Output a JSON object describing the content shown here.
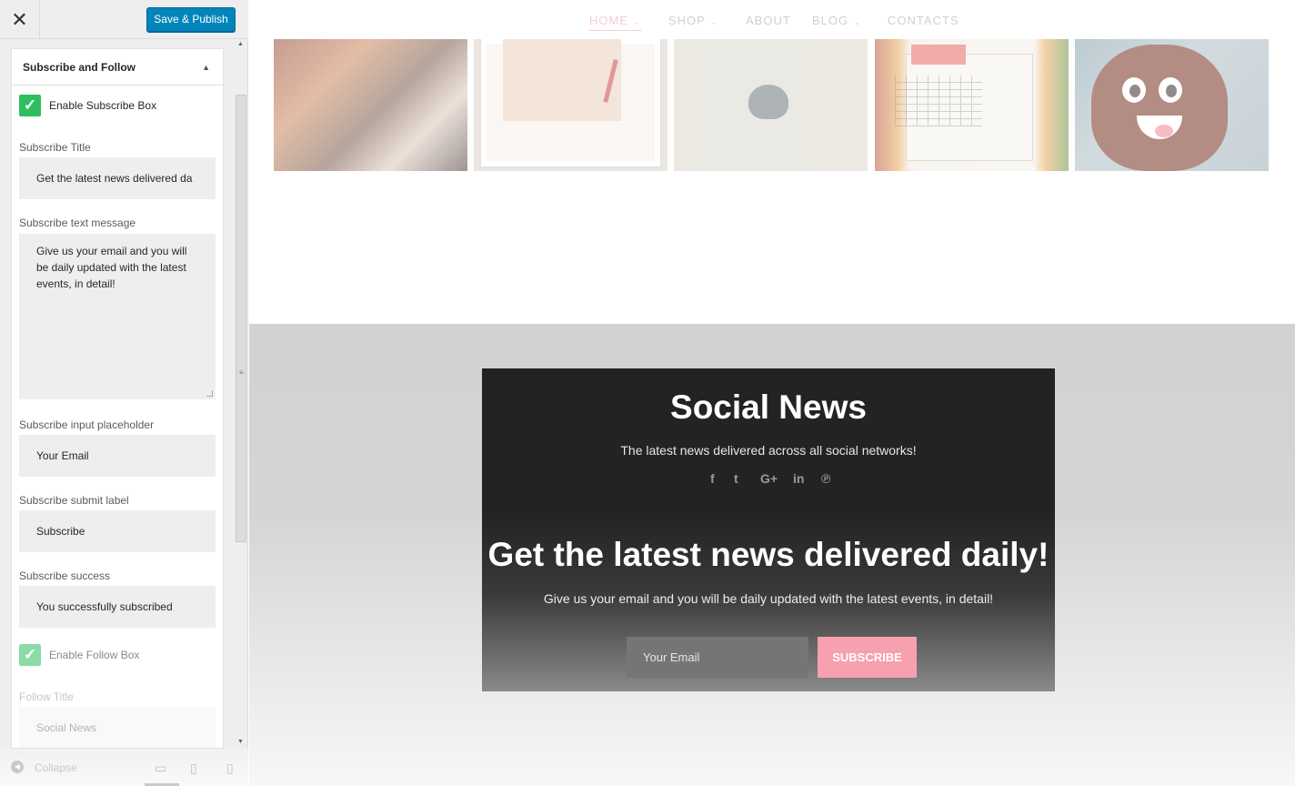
{
  "customizer": {
    "close_glyph": "✕",
    "publish_label": "Save & Publish",
    "section_title": "Subscribe and Follow",
    "enable_subscribe_label": "Enable Subscribe Box",
    "fields": {
      "subscribe_title_label": "Subscribe Title",
      "subscribe_title_value": "Get the latest news delivered da",
      "subscribe_text_label": "Subscribe text message",
      "subscribe_text_value": "Give us your email and you will be daily updated with the latest events, in detail!",
      "input_placeholder_label": "Subscribe input placeholder",
      "input_placeholder_value": "Your Email",
      "submit_label_label": "Subscribe submit label",
      "submit_label_value": "Subscribe",
      "success_label": "Subscribe success",
      "success_value": "You successfully subscribed",
      "enable_follow_label": "Enable Follow Box",
      "follow_title_label": "Follow Title",
      "follow_title_value": "Social News"
    },
    "footer": {
      "collapse_label": "Collapse"
    }
  },
  "preview": {
    "nav": [
      {
        "label": "HOME",
        "has_dropdown": true,
        "active": true
      },
      {
        "label": "SHOP",
        "has_dropdown": true
      },
      {
        "label": "ABOUT"
      },
      {
        "label": "BLOG",
        "has_dropdown": true
      },
      {
        "label": "CONTACTS"
      }
    ],
    "follow_box": {
      "title": "Social News",
      "subtitle": "The latest news delivered across all social networks!",
      "icons": [
        "facebook-icon",
        "twitter-icon",
        "google-plus-icon",
        "linkedin-icon",
        "pinterest-icon"
      ]
    },
    "subscribe_box": {
      "title": "Get the latest news delivered daily!",
      "text": "Give us your email and you will be daily updated with the latest events, in detail!",
      "input_placeholder": "Your Email",
      "button_label": "SUBSCRIBE"
    }
  },
  "colors": {
    "publish_blue": "#0085ba",
    "checkbox_green": "#2fbf60",
    "subscribe_pink": "#f7a0ae",
    "dark_box": "#232323"
  }
}
